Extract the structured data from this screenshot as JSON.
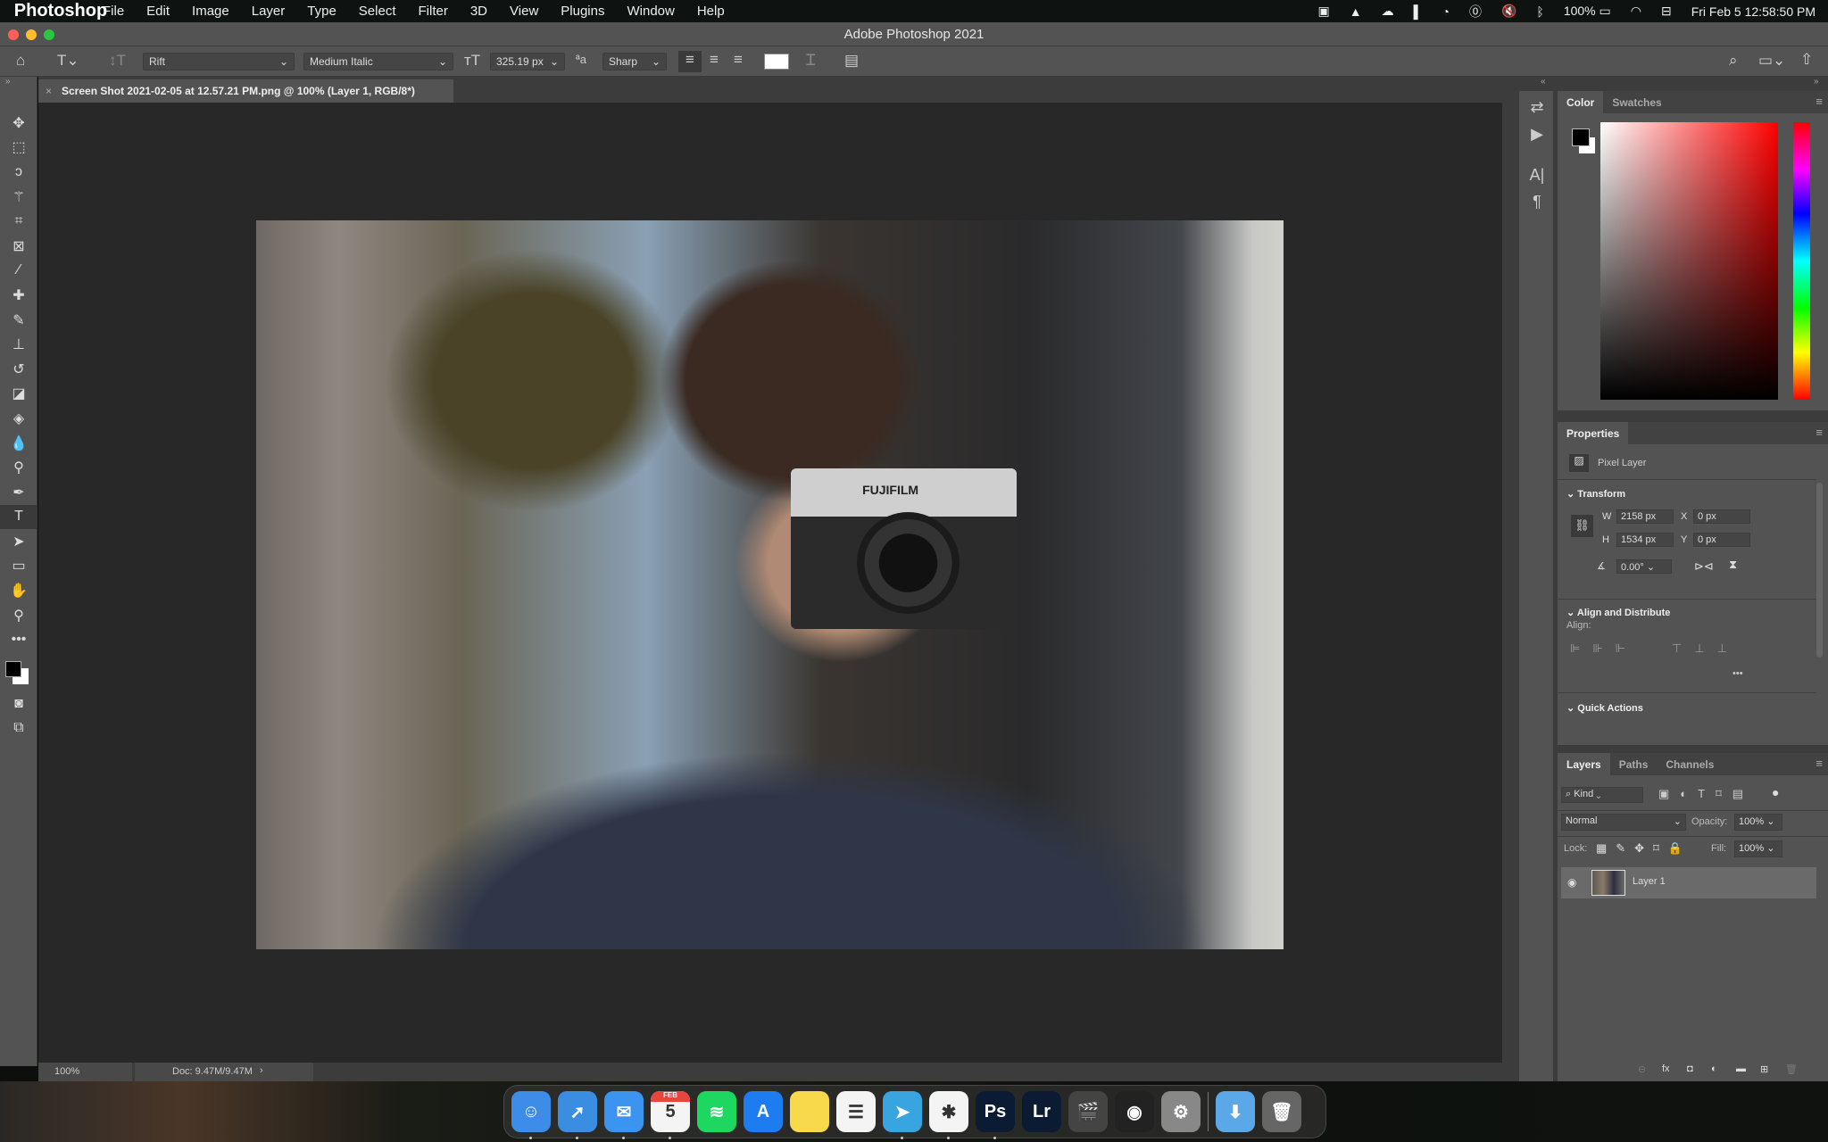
{
  "menubar": {
    "app_name": "Photoshop",
    "items": [
      "File",
      "Edit",
      "Image",
      "Layer",
      "Type",
      "Select",
      "Filter",
      "3D",
      "View",
      "Plugins",
      "Window",
      "Help"
    ],
    "battery": "100%",
    "clock": "Fri Feb 5  12:58:50 PM"
  },
  "window": {
    "title": "Adobe Photoshop 2021"
  },
  "options_bar": {
    "font_family": "Rift",
    "font_style": "Medium Italic",
    "font_size": "325.19 px",
    "antialias": "Sharp",
    "text_color": "#ffffff"
  },
  "document": {
    "tab_title": "Screen Shot 2021-02-05 at 12.57.21 PM.png @ 100% (Layer 1, RGB/8*)",
    "photo_brand_text": "FUJIFILM"
  },
  "tools": [
    "move",
    "rectangular-marquee",
    "lasso",
    "magic-wand",
    "crop",
    "frame",
    "eyedropper",
    "healing-brush",
    "brush",
    "clone-stamp",
    "history-brush",
    "eraser",
    "paint-bucket",
    "blur",
    "dodge",
    "pen",
    "type",
    "path-selection",
    "rectangle",
    "hand",
    "zoom",
    "more"
  ],
  "active_tool": "type",
  "status": {
    "zoom": "100%",
    "doc": "Doc: 9.47M/9.47M"
  },
  "color_panel": {
    "tabs": [
      "Color",
      "Swatches"
    ],
    "foreground": "#000000",
    "background": "#ffffff",
    "hue_color": "#ff0000"
  },
  "properties": {
    "title": "Properties",
    "layer_type": "Pixel Layer",
    "transform": {
      "label": "Transform",
      "w_label": "W",
      "w": "2158 px",
      "h_label": "H",
      "h": "1534 px",
      "x_label": "X",
      "x": "0 px",
      "y_label": "Y",
      "y": "0 px",
      "angle": "0.00°"
    },
    "align": {
      "label": "Align and Distribute",
      "sub": "Align:"
    },
    "quick_actions": "Quick Actions"
  },
  "layers_panel": {
    "tabs": [
      "Layers",
      "Paths",
      "Channels"
    ],
    "filter": "Kind",
    "blend_mode": "Normal",
    "opacity_label": "Opacity:",
    "opacity": "100%",
    "lock_label": "Lock:",
    "fill_label": "Fill:",
    "fill": "100%",
    "layers": [
      {
        "name": "Layer 1",
        "visible": true,
        "selected": true
      }
    ]
  },
  "dock": [
    {
      "name": "Finder",
      "glyph": "☺",
      "color": "#3d8de8",
      "running": true
    },
    {
      "name": "Safari",
      "glyph": "➚",
      "color": "#3a8de0",
      "running": true
    },
    {
      "name": "Mail",
      "glyph": "✉",
      "color": "#3a94f0",
      "running": true
    },
    {
      "name": "Calendar",
      "glyph": "5",
      "month": "FEB",
      "color": "#f4f4f4",
      "running": true
    },
    {
      "name": "Spotify",
      "glyph": "≋",
      "color": "#1ed760",
      "running": false
    },
    {
      "name": "App Store",
      "glyph": "A",
      "color": "#1c7cf0",
      "running": false
    },
    {
      "name": "Notes",
      "glyph": "",
      "color": "#f8d94c",
      "running": false
    },
    {
      "name": "Reminders",
      "glyph": "☰",
      "color": "#f4f4f4",
      "running": false
    },
    {
      "name": "Telegram",
      "glyph": "➤",
      "color": "#38a4e0",
      "running": true
    },
    {
      "name": "Slack",
      "glyph": "✱",
      "color": "#f4f4f4",
      "running": true
    },
    {
      "name": "Ps",
      "glyph": "Ps",
      "color": "#0b1b33",
      "running": true
    },
    {
      "name": "Lr",
      "glyph": "Lr",
      "color": "#0b1b33",
      "running": false
    },
    {
      "name": "Final Cut Pro",
      "glyph": "🎬",
      "color": "#444",
      "running": false
    },
    {
      "name": "Compressor",
      "glyph": "◉",
      "color": "#222",
      "running": false
    },
    {
      "name": "System Preferences",
      "glyph": "⚙",
      "color": "#888",
      "running": false
    },
    {
      "name": "Downloads",
      "glyph": "⬇",
      "color": "#5aa8e8",
      "running": false
    },
    {
      "name": "Trash",
      "glyph": "🗑",
      "color": "#666",
      "running": false
    }
  ]
}
